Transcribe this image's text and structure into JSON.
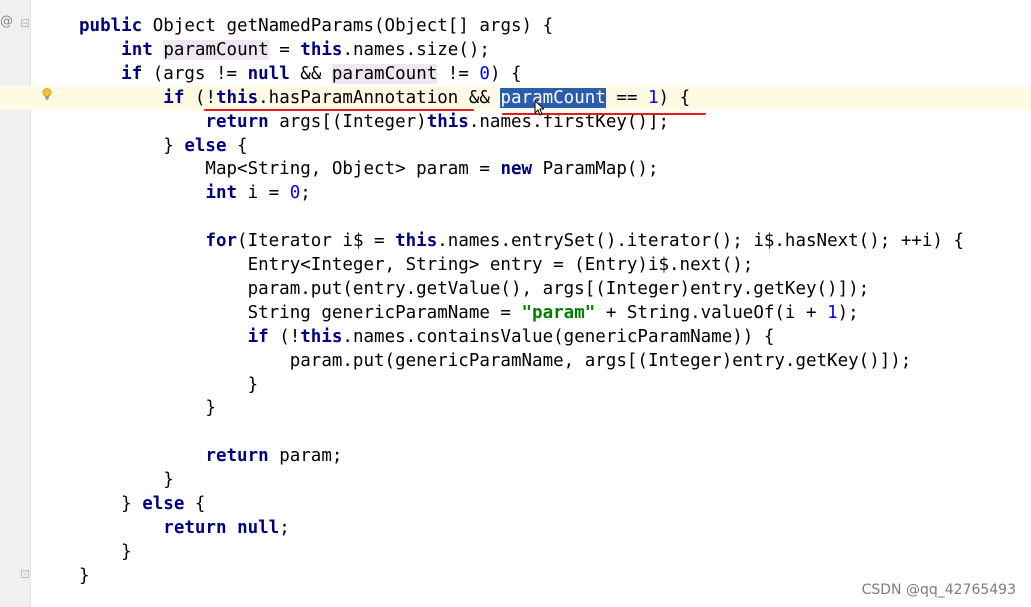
{
  "gutter": {
    "annotation_glyph": "@",
    "fold_open_glyph": "⊟",
    "fold_end_glyph": "⊡"
  },
  "code_lines": [
    [
      {
        "t": "public",
        "c": "kw"
      },
      {
        "t": " Object getNamedParams(Object[] args) {"
      }
    ],
    [
      {
        "t": "    "
      },
      {
        "t": "int",
        "c": "kw"
      },
      {
        "t": " "
      },
      {
        "t": "paramCount",
        "c": "usage"
      },
      {
        "t": " = "
      },
      {
        "t": "this",
        "c": "kw"
      },
      {
        "t": ".names.size();"
      }
    ],
    [
      {
        "t": "    "
      },
      {
        "t": "if",
        "c": "kw"
      },
      {
        "t": " (args != "
      },
      {
        "t": "null",
        "c": "kw"
      },
      {
        "t": " && "
      },
      {
        "t": "paramCount",
        "c": "usage"
      },
      {
        "t": " != "
      },
      {
        "t": "0",
        "c": "num"
      },
      {
        "t": ") {"
      }
    ],
    [
      {
        "t": "        "
      },
      {
        "t": "if",
        "c": "kw"
      },
      {
        "t": " (!"
      },
      {
        "t": "this",
        "c": "kw"
      },
      {
        "t": ".hasParamAnnotation && "
      },
      {
        "t": "paramCount",
        "c": "sel"
      },
      {
        "t": " == "
      },
      {
        "t": "1",
        "c": "num"
      },
      {
        "t": ") {"
      }
    ],
    [
      {
        "t": "            "
      },
      {
        "t": "return",
        "c": "kw"
      },
      {
        "t": " args[(Integer)"
      },
      {
        "t": "this",
        "c": "kw"
      },
      {
        "t": ".names.firstKey()];"
      }
    ],
    [
      {
        "t": "        } "
      },
      {
        "t": "else",
        "c": "kw"
      },
      {
        "t": " {"
      }
    ],
    [
      {
        "t": "            Map<String, Object> param = "
      },
      {
        "t": "new",
        "c": "kw"
      },
      {
        "t": " ParamMap();"
      }
    ],
    [
      {
        "t": "            "
      },
      {
        "t": "int",
        "c": "kw"
      },
      {
        "t": " i = "
      },
      {
        "t": "0",
        "c": "num"
      },
      {
        "t": ";"
      }
    ],
    [],
    [
      {
        "t": "            "
      },
      {
        "t": "for",
        "c": "kw"
      },
      {
        "t": "(Iterator i$ = "
      },
      {
        "t": "this",
        "c": "kw"
      },
      {
        "t": ".names.entrySet().iterator(); i$.hasNext(); ++i) {"
      }
    ],
    [
      {
        "t": "                Entry<Integer, String> entry = (Entry)i$.next();"
      }
    ],
    [
      {
        "t": "                param.put(entry.getValue(), args[(Integer)entry.getKey()]);"
      }
    ],
    [
      {
        "t": "                String genericParamName = "
      },
      {
        "t": "\"param\"",
        "c": "str"
      },
      {
        "t": " + String.valueOf(i + "
      },
      {
        "t": "1",
        "c": "num"
      },
      {
        "t": ");"
      }
    ],
    [
      {
        "t": "                "
      },
      {
        "t": "if",
        "c": "kw"
      },
      {
        "t": " (!"
      },
      {
        "t": "this",
        "c": "kw"
      },
      {
        "t": ".names.containsValue(genericParamName)) {"
      }
    ],
    [
      {
        "t": "                    param.put(genericParamName, args[(Integer)entry.getKey()]);"
      }
    ],
    [
      {
        "t": "                }"
      }
    ],
    [
      {
        "t": "            }"
      }
    ],
    [],
    [
      {
        "t": "            "
      },
      {
        "t": "return",
        "c": "kw"
      },
      {
        "t": " param;"
      }
    ],
    [
      {
        "t": "        }"
      }
    ],
    [
      {
        "t": "    } "
      },
      {
        "t": "else",
        "c": "kw"
      },
      {
        "t": " {"
      }
    ],
    [
      {
        "t": "        "
      },
      {
        "t": "return",
        "c": "kw"
      },
      {
        "t": " "
      },
      {
        "t": "null",
        "c": "kw"
      },
      {
        "t": ";"
      }
    ],
    [
      {
        "t": "    }"
      }
    ],
    [
      {
        "t": "}"
      }
    ]
  ],
  "current_line_index": 3,
  "watermark": "CSDN @qq_42765493"
}
